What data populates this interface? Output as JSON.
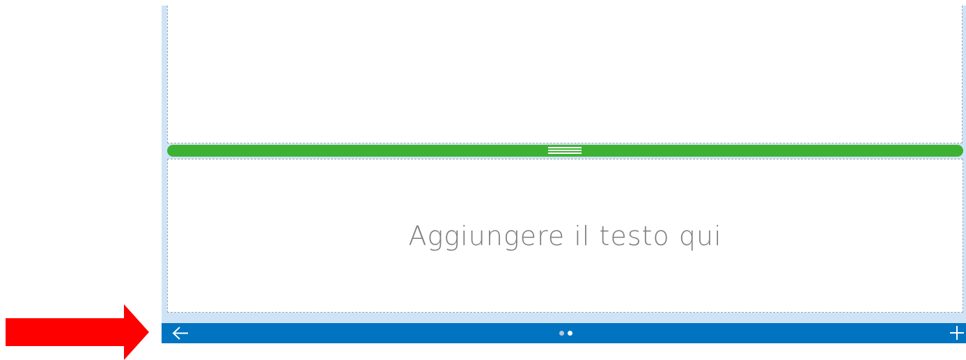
{
  "editor": {
    "placeholder_text": "Aggiungere il testo qui"
  },
  "toolbar": {
    "back_icon": "arrow-left-icon",
    "add_icon": "plus-icon",
    "page_indicator": {
      "total_pages": 2,
      "current_page": 2
    }
  },
  "colors": {
    "frame": "#cfe3f6",
    "splitter": "#3db232",
    "toolbar": "#0074c1",
    "placeholder_text": "#7d7d7d",
    "annotation_arrow": "#ff0000",
    "dot_active": "#ffffff",
    "dot_inactive": "#b8c7d6"
  },
  "annotation": {
    "arrow_icon": "red-arrow-right-icon"
  }
}
